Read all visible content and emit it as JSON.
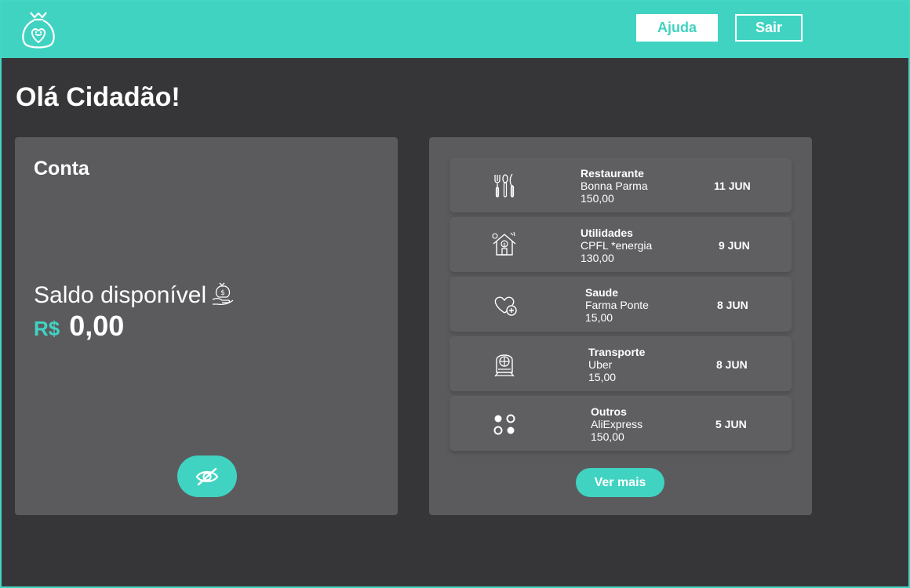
{
  "header": {
    "help_label": "Ajuda",
    "logout_label": "Sair",
    "accent_color": "#41d3c1"
  },
  "greeting": "Olá Cidadão!",
  "account": {
    "title": "Conta",
    "balance_label": "Saldo disponível",
    "currency": "R$",
    "balance": "0,00",
    "balance_icon": "money-bag-hand-icon",
    "toggle_icon": "eye-off-icon"
  },
  "transactions": [
    {
      "category": "Restaurante",
      "merchant": "Bonna Parma",
      "amount": "150,00",
      "date": "11 JUN",
      "icon": "cutlery-icon"
    },
    {
      "category": "Utilidades",
      "merchant": "CPFL *energia",
      "amount": "130,00",
      "date": "9 JUN",
      "icon": "house-bill-icon"
    },
    {
      "category": "Saude",
      "merchant": "Farma Ponte",
      "amount": "15,00",
      "date": "8 JUN",
      "icon": "heart-health-icon"
    },
    {
      "category": "Transporte",
      "merchant": "Uber",
      "amount": "15,00",
      "date": "8 JUN",
      "icon": "train-icon"
    },
    {
      "category": "Outros",
      "merchant": "AliExpress",
      "amount": "150,00",
      "date": "5 JUN",
      "icon": "dots-grid-icon"
    }
  ],
  "see_more_label": "Ver mais"
}
